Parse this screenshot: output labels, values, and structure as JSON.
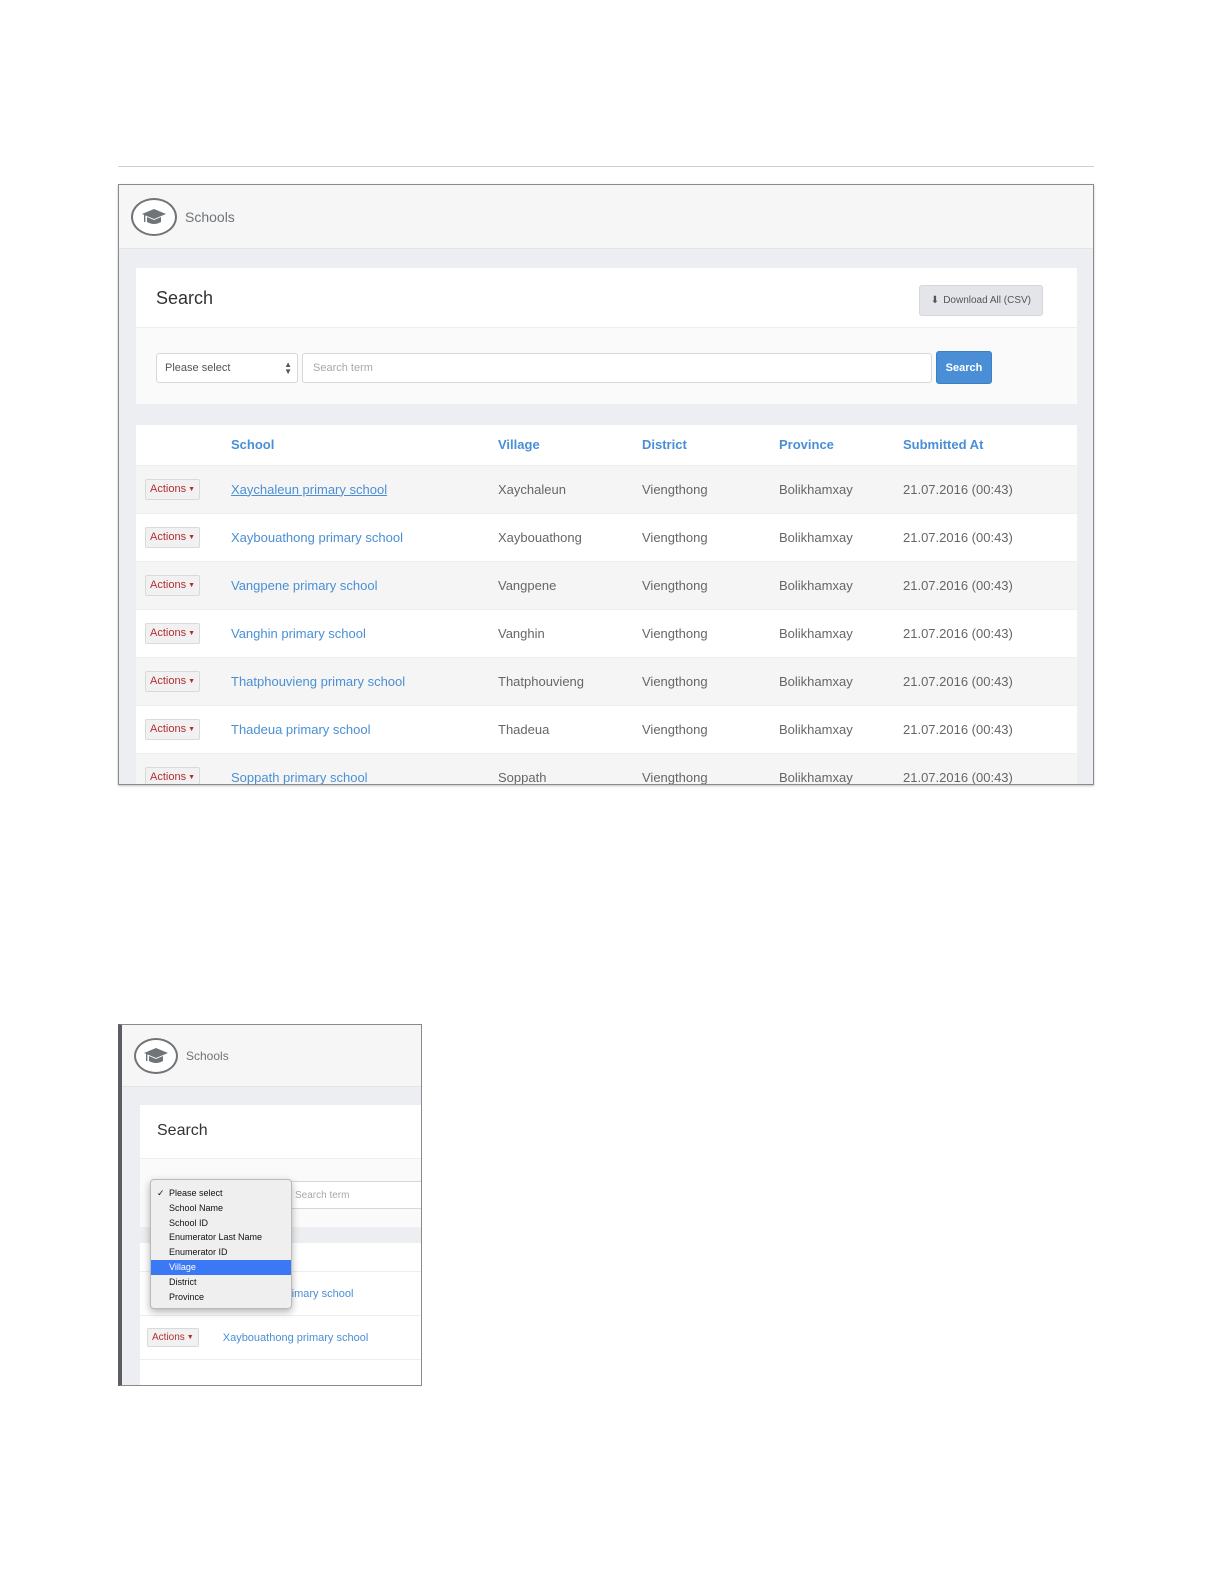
{
  "app": {
    "title": "Schools",
    "logo_icon": "graduation-cap-icon"
  },
  "search": {
    "title": "Search",
    "download_label": "Download All (CSV)",
    "select_value": "Please select",
    "placeholder": "Search term",
    "button_label": "Search"
  },
  "table": {
    "columns": [
      "School",
      "Village",
      "District",
      "Province",
      "Submitted At"
    ],
    "actions_label": "Actions",
    "rows": [
      {
        "school": "Xaychaleun primary school",
        "village": "Xaychaleun",
        "district": "Viengthong",
        "province": "Bolikhamxay",
        "submitted": "21.07.2016 (00:43)"
      },
      {
        "school": "Xaybouathong primary school",
        "village": "Xaybouathong",
        "district": "Viengthong",
        "province": "Bolikhamxay",
        "submitted": "21.07.2016 (00:43)"
      },
      {
        "school": "Vangpene primary school",
        "village": "Vangpene",
        "district": "Viengthong",
        "province": "Bolikhamxay",
        "submitted": "21.07.2016 (00:43)"
      },
      {
        "school": "Vanghin primary school",
        "village": "Vanghin",
        "district": "Viengthong",
        "province": "Bolikhamxay",
        "submitted": "21.07.2016 (00:43)"
      },
      {
        "school": "Thatphouvieng primary school",
        "village": "Thatphouvieng",
        "district": "Viengthong",
        "province": "Bolikhamxay",
        "submitted": "21.07.2016 (00:43)"
      },
      {
        "school": "Thadeua primary school",
        "village": "Thadeua",
        "district": "Viengthong",
        "province": "Bolikhamxay",
        "submitted": "21.07.2016 (00:43)"
      },
      {
        "school": "Soppath primary school",
        "village": "Soppath",
        "district": "Viengthong",
        "province": "Bolikhamxay",
        "submitted": "21.07.2016 (00:43)"
      }
    ]
  },
  "dropdown": {
    "options": [
      "Please select",
      "School Name",
      "School ID",
      "Enumerator Last Name",
      "Enumerator ID",
      "Village",
      "District",
      "Province"
    ],
    "checked": "Please select",
    "highlighted": "Village"
  },
  "shot2": {
    "partial_school": "rimary school",
    "row2_school": "Xaybouathong primary school"
  },
  "colors": {
    "accent": "#4a8fd6",
    "actions_text": "#b03030",
    "highlight": "#3b78f5"
  }
}
